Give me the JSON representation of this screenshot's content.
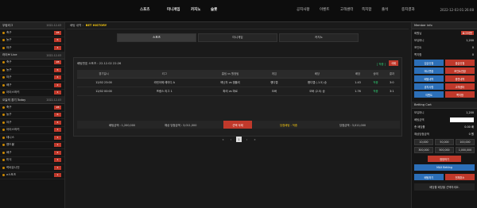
{
  "nav": {
    "left": [
      "스포츠",
      "미니게임",
      "카지노",
      "슬롯"
    ],
    "right": [
      "공지사항",
      "이벤트",
      "고객센터",
      "쪽지함",
      "출석",
      "중지결과"
    ],
    "clock": "2022-12-03 01:26:08"
  },
  "left": {
    "groups": [
      {
        "title": "무림리그",
        "date": "2022-12-03",
        "items": [
          {
            "n": "축구",
            "c": "28"
          },
          {
            "n": "농구",
            "c": "6"
          },
          {
            "n": "야구",
            "c": "4"
          }
        ]
      },
      {
        "title": "라이브 Live",
        "date": "2022-12-03",
        "items": [
          {
            "n": "축구",
            "c": "28"
          },
          {
            "n": "농구",
            "c": "6"
          },
          {
            "n": "야구",
            "c": "4"
          },
          {
            "n": "배구",
            "c": "2"
          },
          {
            "n": "아이스하키",
            "c": "1"
          }
        ]
      },
      {
        "title": "오늘의 경기 Today",
        "date": "2022-12-03",
        "items": [
          {
            "n": "축구",
            "c": "28"
          },
          {
            "n": "농구",
            "c": "6"
          },
          {
            "n": "야구",
            "c": "4"
          },
          {
            "n": "아이스하키",
            "c": "1"
          },
          {
            "n": "테니스",
            "c": "1"
          },
          {
            "n": "핸드볼",
            "c": "1"
          },
          {
            "n": "배구",
            "c": "2"
          },
          {
            "n": "미식",
            "c": "1"
          },
          {
            "n": "럭비유니언",
            "c": "1"
          },
          {
            "n": "e스포츠",
            "c": "1"
          }
        ]
      }
    ]
  },
  "main": {
    "msg_label": "배팅 내역 :",
    "msg_value": "BET HISTORY",
    "tabs": [
      "스포츠",
      "미니게임",
      "카지노"
    ],
    "box_head": "배팅번호 스포츠 : 22.12.02 22:26",
    "box_status": "[ 적중 ]",
    "box_del": "삭제",
    "headers": [
      "경기일시",
      "리그",
      "홈팀 vs 원정팀",
      "게임",
      "배당",
      "배당",
      "상태",
      "결과"
    ],
    "rows": [
      [
        "12/02 23:00",
        "라틴아메 레이디 A",
        "메닌자 vs 엠플리",
        "핸디캡",
        "핸디캡 (-1.5) 승",
        "1.43",
        "적중",
        "3:0"
      ],
      [
        "12/02 00:00",
        "프랑스 리그 1",
        "파리 vs 마르",
        "오버",
        "오버 (2.5) 승",
        "1.76",
        "적중",
        "3:1"
      ]
    ],
    "sum": {
      "a": "배팅금액 : 1,200,000",
      "b": "예상 당첨금액 : 3,011,000",
      "c": "배당 배당 : 2.51",
      "d": "당첨배팅 : 적중",
      "e": "당첨금액 : 3,011,000"
    },
    "delete_btn": "선택 삭제",
    "pages": [
      "«",
      "‹",
      "1",
      "›",
      "»"
    ]
  },
  "right": {
    "member_title": "Member info",
    "member_rows": [
      {
        "k": "화원님",
        "v": "로그아웃"
      },
      {
        "k": "보유머니",
        "v": "1,200"
      },
      {
        "k": "포인트",
        "v": "0"
      },
      {
        "k": "쪽지함",
        "v": "0"
      }
    ],
    "btns": [
      "입금신청",
      "출금신청",
      "머니변환",
      "포인트전환",
      "베팅내역",
      "충전내역",
      "공지사항",
      "고객센터",
      "이벤트",
      "쪽지함"
    ],
    "cart_title": "Betting Cart",
    "cart_rows": [
      {
        "k": "보유머니",
        "v": "1,200"
      },
      {
        "k": "베팅금액",
        "v": ""
      },
      {
        "k": "총 배당률",
        "v": "0.00 배"
      },
      {
        "k": "예상당첨금액",
        "v": "0 원"
      }
    ],
    "amounts": [
      "10,000",
      "50,000",
      "100,000",
      "300,000",
      "500,000",
      "1,000,000"
    ],
    "reset": "정정하기",
    "max_btn": "MAX Betting",
    "bet_btn": "베팅하기",
    "clear_btn": "전체취소",
    "notice": "배당할 배당을 선택하세요."
  }
}
